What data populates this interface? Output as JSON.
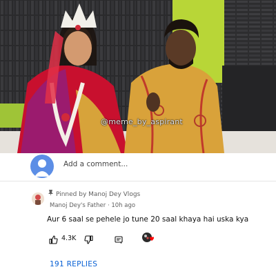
{
  "video": {
    "watermark": "@meme_by_aspirant"
  },
  "comments": {
    "add_placeholder": "Add a comment...",
    "pinned": {
      "pinned_label": "Pinned by Manoj Dey Vlogs",
      "author": "Manoj Dey's Father",
      "time": "10h ago",
      "text": "Aur 6 saal se pehele jo tune 20 saal khaya hai uska kya",
      "like_count": "4.3K",
      "replies_label": "191 REPLIES"
    }
  },
  "icons": {
    "pin": "pin-icon",
    "like": "thumbs-up-icon",
    "dislike": "thumbs-down-icon",
    "reply": "reply-icon",
    "heart": "creator-heart-icon"
  },
  "colors": {
    "link_blue": "#065fd4",
    "avatar_blue": "#5c8ee6",
    "heart_red": "#ff0000"
  }
}
